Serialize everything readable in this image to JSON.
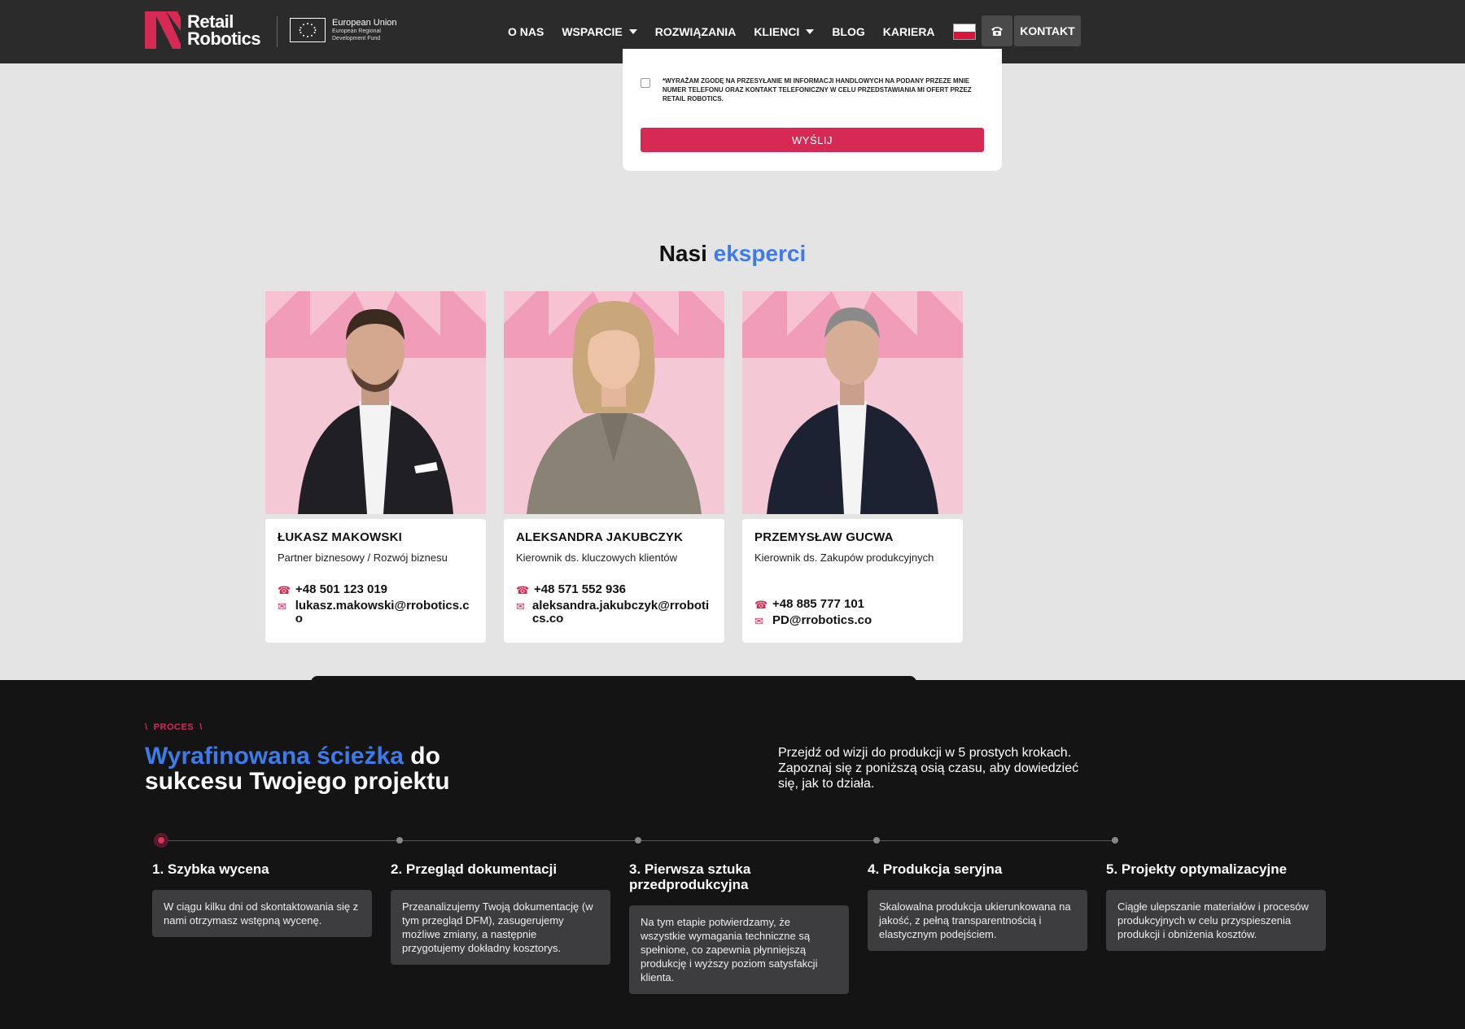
{
  "nav": {
    "logo_line1": "Retail",
    "logo_line2": "Robotics",
    "eu_title": "European Union",
    "eu_sub1": "European Regional",
    "eu_sub2": "Development Fund",
    "items": [
      {
        "label": "O NAS"
      },
      {
        "label": "WSPARCIE"
      },
      {
        "label": "ROZWIĄZANIA"
      },
      {
        "label": "KLIENCI"
      },
      {
        "label": "BLOG"
      },
      {
        "label": "KARIERA"
      }
    ],
    "contact_label": "KONTAKT"
  },
  "form": {
    "consent_text": "*WYRAŻAM ZGODĘ NA PRZESYŁANIE MI INFORMACJI HANDLOWYCH NA PODANY PRZEZE MNIE NUMER TELEFONU ORAZ KONTAKT TELEFONICZNY W CELU PRZEDSTAWIANIA MI OFERT PRZEZ RETAIL ROBOTICS.",
    "required_mark": "*",
    "submit_label": "WYŚLIJ"
  },
  "experts": {
    "title_plain": "Nasi",
    "title_highlight": "eksperci",
    "people": [
      {
        "name": "ŁUKASZ MAKOWSKI",
        "role": "Partner biznesowy / Rozwój biznesu",
        "phone": "+48 501 123 019",
        "email": "lukasz.makowski@rrobotics.co"
      },
      {
        "name": "ALEKSANDRA JAKUBCZYK",
        "role": "Kierownik ds. kluczowych klientów",
        "phone": "+48 571 552 936",
        "email": "aleksandra.jakubczyk@rrobotics.co"
      },
      {
        "name": "PRZEMYSŁAW GUCWA",
        "role": "Kierownik ds. Zakupów produkcyjnych",
        "phone": "+48 885 777 101",
        "email": "PD@rrobotics.co"
      }
    ]
  },
  "process": {
    "eyebrow": "PROCES",
    "title_highlight": "Wyrafinowana ścieżka",
    "title_rest1": " do",
    "title_rest2": "sukcesu Twojego projektu",
    "description": "Przejdź od wizji do produkcji w 5 prostych krokach. Zapoznaj się z poniższą osią czasu, aby dowiedzieć się, jak to działa.",
    "steps": [
      {
        "title": "1. Szybka wycena",
        "text": "W ciągu kilku dni od skontaktowania się z nami otrzymasz wstępną wycenę."
      },
      {
        "title": "2. Przegląd dokumentacji",
        "text": "Przeanalizujemy Twoją dokumentację (w tym przegląd DFM), zasugerujemy możliwe zmiany, a następnie przygotujemy dokładny kosztorys."
      },
      {
        "title": "3. Pierwsza sztuka przedprodukcyjna",
        "text": "Na tym etapie potwierdzamy, że wszystkie wymagania techniczne są spełnione, co zapewnia płynniejszą produkcję i wyższy poziom satysfakcji klienta."
      },
      {
        "title": "4. Produkcja seryjna",
        "text": "Skalowalna produkcja ukierunkowana na jakość, z pełną transparentnością i elastycznym podejściem."
      },
      {
        "title": "5. Projekty optymalizacyjne",
        "text": "Ciągłe ulepszanie materiałów i procesów produkcyjnych w celu przyspieszenia produkcji i obniżenia kosztów."
      }
    ]
  },
  "colors": {
    "accent_pink": "#d62a55",
    "accent_blue": "#3e7bea",
    "nav_bg": "#2b2b2b",
    "dark_bg": "#141414"
  },
  "icons": {
    "phone": "phone-icon",
    "email": "mail-icon",
    "language": "poland-flag-icon"
  }
}
